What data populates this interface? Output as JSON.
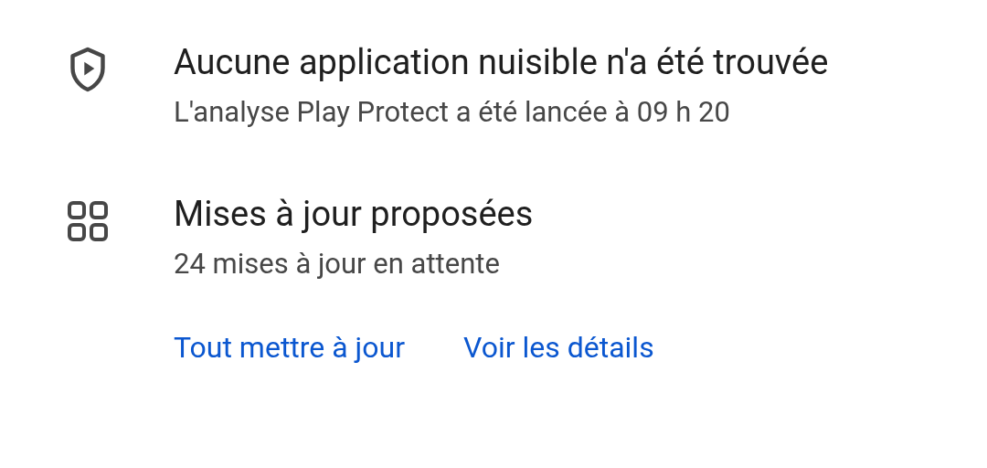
{
  "items": [
    {
      "kind": "shield",
      "title": "Aucune application nuisible n'a été trouvée",
      "subtitle": "L'analyse Play Protect a été lancée à 09 h 20"
    },
    {
      "kind": "grid",
      "title": "Mises à jour proposées",
      "subtitle": "24 mises à jour en attente"
    }
  ],
  "actions": [
    "Tout mettre à jour",
    "Voir les détails"
  ]
}
